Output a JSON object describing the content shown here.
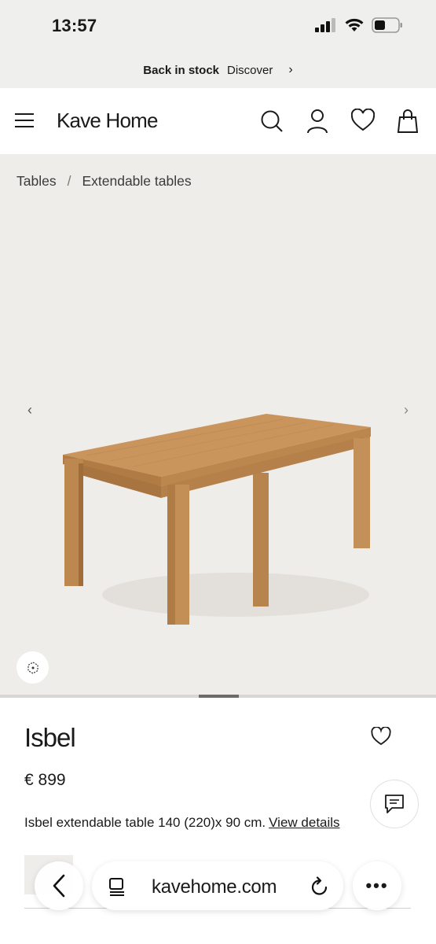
{
  "status_bar": {
    "time": "13:57"
  },
  "promo": {
    "bold_text": "Back in stock",
    "link_text": "Discover",
    "chevron": "›"
  },
  "header": {
    "brand": "Kave Home"
  },
  "breadcrumb": {
    "items": [
      "Tables",
      "Extendable tables"
    ],
    "separator": "/"
  },
  "gallery": {
    "prev_arrow": "‹",
    "next_arrow": "›",
    "progress_fraction": 0.1
  },
  "product": {
    "name": "Isbel",
    "price": "€ 899",
    "description": "Isbel extendable table 140 (220)x 90 cm.",
    "view_details": "View details"
  },
  "browser": {
    "url": "kavehome.com",
    "more": "•••",
    "back": "‹"
  },
  "colors": {
    "accent": "#1a1a1a",
    "hero_bg": "#efedea",
    "wood": "#c9955c"
  },
  "icons": [
    "menu-icon",
    "search-icon",
    "user-icon",
    "heart-icon",
    "bag-icon",
    "ar-view-icon",
    "chat-icon",
    "reader-icon",
    "reload-icon"
  ]
}
